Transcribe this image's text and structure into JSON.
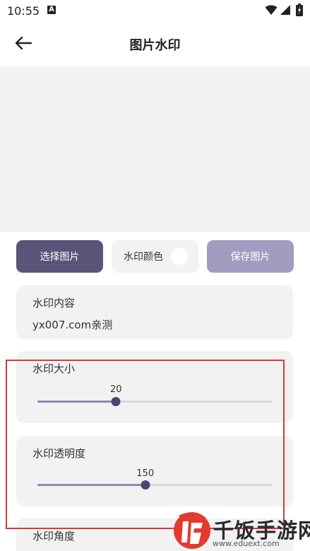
{
  "status": {
    "time": "10:55",
    "notif_letter": "A"
  },
  "appbar": {
    "title": "图片水印",
    "back_icon": "arrow-left-icon"
  },
  "actions": {
    "select_label": "选择图片",
    "color_label": "水印颜色",
    "color_value": "#ffffff",
    "save_label": "保存图片"
  },
  "content": {
    "label": "水印内容",
    "value": "yx007.com亲测"
  },
  "size": {
    "label": "水印大小",
    "value": "20",
    "fraction": 0.335
  },
  "alpha": {
    "label": "水印透明度",
    "value": "150",
    "fraction": 0.46
  },
  "angle": {
    "label": "水印角度"
  },
  "colors": {
    "primary": "#5c5378",
    "primary_light": "#a19cc0",
    "highlight": "#d93a3a"
  },
  "watermark": {
    "name": "千饭手游网",
    "url": "www.eduext.com"
  }
}
